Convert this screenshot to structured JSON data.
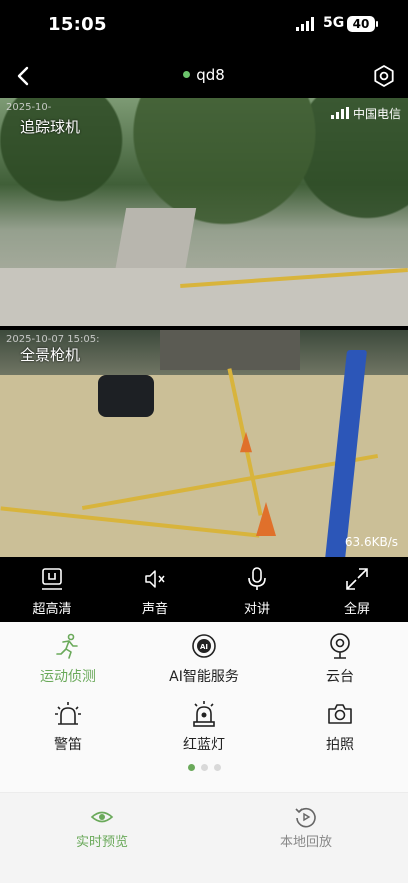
{
  "status_bar": {
    "time": "15:05",
    "network": "5G",
    "battery": "40"
  },
  "header": {
    "title": "qd8"
  },
  "video": {
    "top": {
      "label": "追踪球机",
      "timestamp": "2025-10-",
      "carrier": "中国电信"
    },
    "bottom": {
      "label": "全景枪机",
      "timestamp": "2025-10-07 15:05:",
      "bitrate": "63.6KB/s"
    }
  },
  "controls": [
    {
      "label": "超高清",
      "icon": "hd-quality-icon"
    },
    {
      "label": "声音",
      "icon": "mute-icon"
    },
    {
      "label": "对讲",
      "icon": "microphone-icon"
    },
    {
      "label": "全屏",
      "icon": "fullscreen-icon"
    }
  ],
  "functions": [
    {
      "label": "运动侦测",
      "icon": "running-person-icon",
      "active": true
    },
    {
      "label": "AI智能服务",
      "icon": "ai-icon",
      "active": false
    },
    {
      "label": "云台",
      "icon": "ptz-camera-icon",
      "active": false
    },
    {
      "label": "警笛",
      "icon": "siren-icon",
      "active": false
    },
    {
      "label": "红蓝灯",
      "icon": "alarm-light-icon",
      "active": false
    },
    {
      "label": "拍照",
      "icon": "camera-icon",
      "active": false
    }
  ],
  "pagination": {
    "current": 1,
    "total": 3
  },
  "tabs": [
    {
      "label": "实时预览",
      "icon": "eye-icon",
      "active": true
    },
    {
      "label": "本地回放",
      "icon": "replay-icon",
      "active": false
    }
  ],
  "colors": {
    "accent": "#6aa95a",
    "online": "#6bc36b",
    "panel_bg": "#fafafa"
  }
}
